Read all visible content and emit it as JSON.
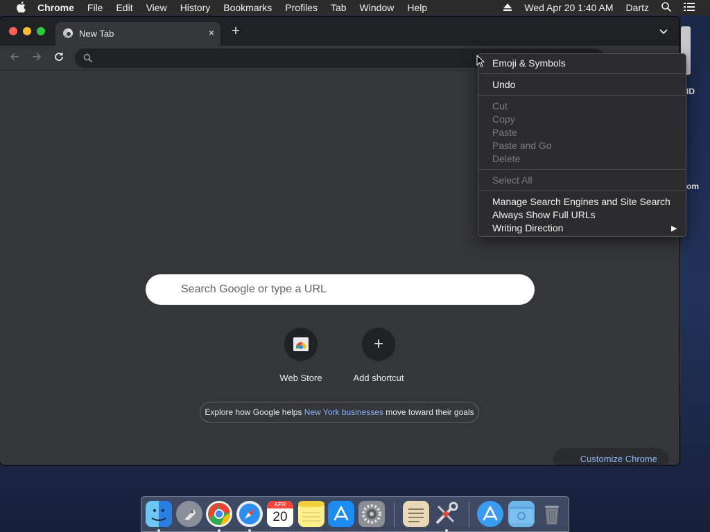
{
  "menubar": {
    "items": [
      "Chrome",
      "File",
      "Edit",
      "View",
      "History",
      "Bookmarks",
      "Profiles",
      "Tab",
      "Window",
      "Help"
    ],
    "clock": "Wed Apr 20  1:40 AM",
    "user": "Dartz",
    "icons": [
      "apple-icon",
      "eject-icon",
      "spotlight-icon",
      "control-center-icon"
    ]
  },
  "desktop": {
    "labels": [
      "ID",
      "om"
    ]
  },
  "browser": {
    "tab_title": "New Tab",
    "tab_close": "×",
    "new_tab": "+",
    "search_placeholder": "Search Google or type a URL",
    "shortcuts": [
      {
        "label": "Web Store",
        "icon": "web-store-icon"
      },
      {
        "label": "Add shortcut",
        "icon": "plus-icon"
      }
    ],
    "promo": {
      "before": "Explore how Google helps ",
      "link": "New York businesses",
      "after": " move toward their goals"
    },
    "customize": "Customize Chrome"
  },
  "context_menu": {
    "items": [
      {
        "label": "Emoji & Symbols",
        "enabled": true
      },
      {
        "label": "Undo",
        "enabled": true
      },
      {
        "label": "Cut",
        "enabled": false
      },
      {
        "label": "Copy",
        "enabled": false
      },
      {
        "label": "Paste",
        "enabled": false
      },
      {
        "label": "Paste and Go",
        "enabled": false
      },
      {
        "label": "Delete",
        "enabled": false
      },
      {
        "label": "Select All",
        "enabled": false
      },
      {
        "label": "Manage Search Engines and Site Search",
        "enabled": true
      },
      {
        "label": "Always Show Full URLs",
        "enabled": true
      },
      {
        "label": "Writing Direction",
        "enabled": true,
        "submenu": true
      }
    ],
    "submenu_arrow": "▶"
  },
  "dock": {
    "apps": [
      "Finder",
      "Launchpad",
      "Google Chrome",
      "Safari",
      "Calendar",
      "Notes",
      "App Store",
      "System Preferences",
      "TextEdit",
      "Utilities",
      "Downloads",
      "Folder",
      "Trash"
    ],
    "calendar_month": "APR",
    "calendar_day": "20"
  },
  "colors": {
    "window_bg": "#35363a",
    "tabstrip_bg": "#202124",
    "link_blue": "#8ab4f8",
    "traffic_red": "#ff5f57",
    "traffic_yellow": "#febc2e",
    "traffic_green": "#28c840"
  }
}
